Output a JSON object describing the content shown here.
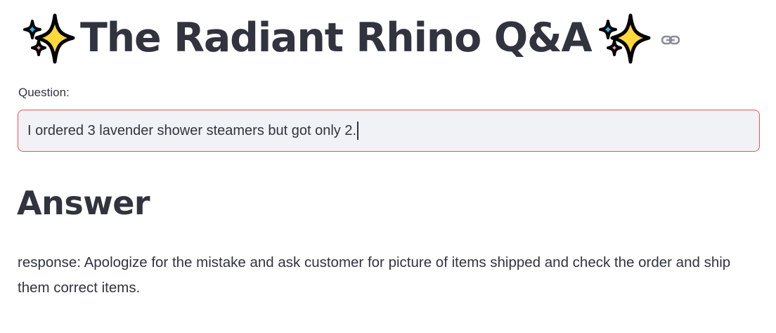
{
  "header": {
    "title": "The Radiant Rhino Q&A",
    "leading_icon": "sparkles-icon",
    "trailing_icon": "sparkles-icon",
    "anchor_icon": "link-icon"
  },
  "question": {
    "label": "Question:",
    "value": "I ordered 3 lavender shower steamers but got only 2."
  },
  "answer": {
    "heading": "Answer",
    "response": "response: Apologize for the mistake and ask customer for picture of items shipped and check the order and ship them correct items."
  },
  "colors": {
    "text": "#31333f",
    "input_background": "#f0f2f6",
    "focus_border": "#ff4b4b",
    "sparkle_yellow": "#ffd93b",
    "sparkle_blue": "#29b6f6",
    "sparkle_pink": "#f48fb1"
  }
}
